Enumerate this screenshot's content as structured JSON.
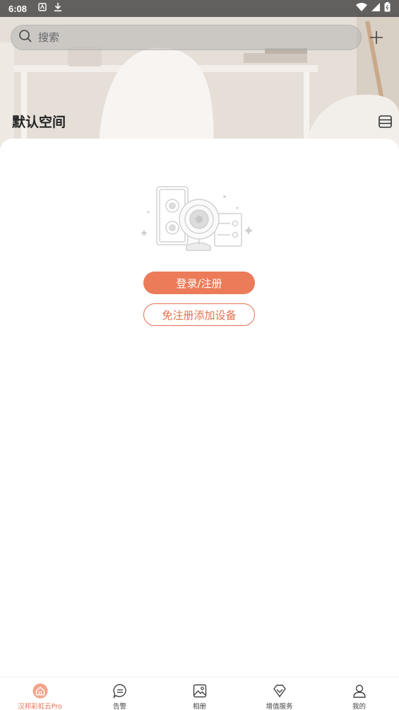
{
  "status_bar": {
    "time": "6:08"
  },
  "search": {
    "placeholder": "搜索"
  },
  "space": {
    "title": "默认空间"
  },
  "empty_state": {
    "login_label": "登录/注册",
    "add_device_label": "免注册添加设备"
  },
  "tabs": [
    {
      "label": "汉邦彩虹云Pro",
      "icon": "home-icon",
      "active": true
    },
    {
      "label": "告警",
      "icon": "alarm-message-icon",
      "active": false
    },
    {
      "label": "相册",
      "icon": "photo-album-icon",
      "active": false
    },
    {
      "label": "增值服务",
      "icon": "diamond-icon",
      "active": false
    },
    {
      "label": "我的",
      "icon": "user-icon",
      "active": false
    }
  ],
  "colors": {
    "accent": "#ec7b59",
    "accent_outline": "#e4714f"
  }
}
